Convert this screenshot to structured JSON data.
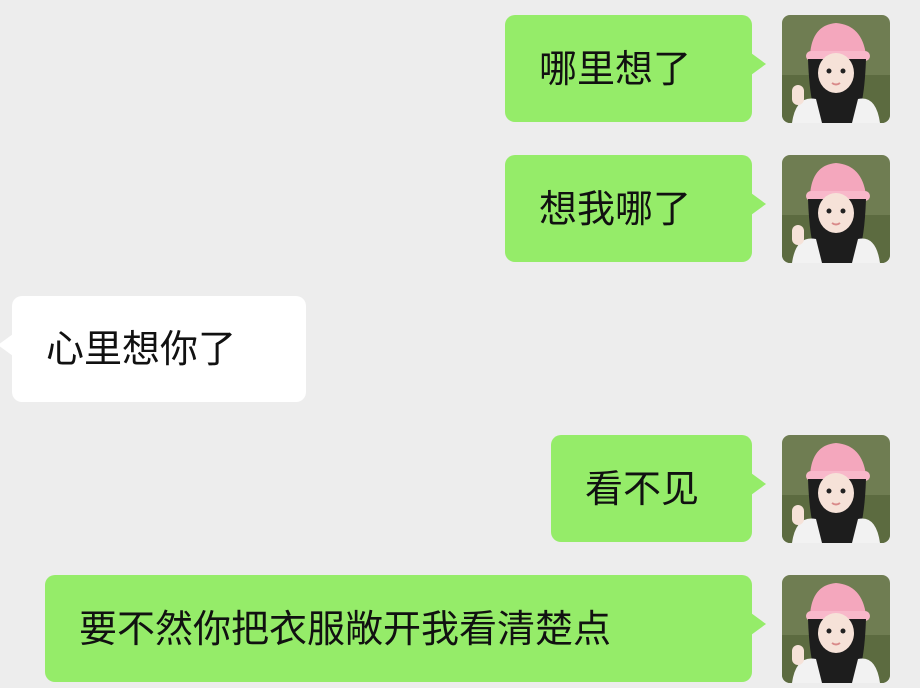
{
  "messages": [
    {
      "side": "sent",
      "text": "哪里想了"
    },
    {
      "side": "sent",
      "text": "想我哪了"
    },
    {
      "side": "received",
      "text": "心里想你了"
    },
    {
      "side": "sent",
      "text": "看不见"
    },
    {
      "side": "sent",
      "text": "要不然你把衣服敞开我看清楚点"
    }
  ],
  "colors": {
    "background": "#ededed",
    "sent_bubble": "#95ec69",
    "received_bubble": "#ffffff",
    "text": "#111111"
  },
  "avatar": {
    "icon": "user-avatar-photo"
  }
}
